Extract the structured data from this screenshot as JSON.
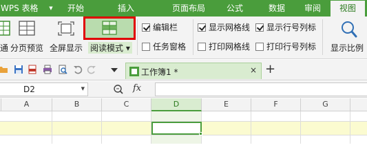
{
  "app": {
    "name": "WPS 表格",
    "menu_dropdown": "▼"
  },
  "menu": {
    "tabs": [
      "开始",
      "插入",
      "页面布局",
      "公式",
      "数据",
      "审阅",
      "视图"
    ],
    "active": "视图"
  },
  "ribbon": {
    "left_cut_label": "通",
    "page_preview": "分页预览",
    "fullscreen": "全屏显示",
    "reading_mode": "阅读模式",
    "reading_mode_dd": "▾",
    "checks": [
      {
        "label": "编辑栏",
        "checked": true
      },
      {
        "label": "任务窗格",
        "checked": false
      },
      {
        "label": "显示网格线",
        "checked": true
      },
      {
        "label": "打印网格线",
        "checked": false
      },
      {
        "label": "显示行号列标",
        "checked": true
      },
      {
        "label": "打印行号列标",
        "checked": false
      }
    ],
    "zoom": "显示比例",
    "highlight_color": "#e00000",
    "accent_color": "#4a9d3c"
  },
  "quick_access": {
    "icons": [
      "open-folder-icon",
      "save-icon",
      "export-pdf-icon",
      "print-icon",
      "print-preview-icon",
      "undo-icon",
      "redo-icon",
      "customize-dropdown-icon"
    ],
    "document_tab": "工作簿1 *",
    "close": "×",
    "new_tab": "+"
  },
  "formula_bar": {
    "name_box": "D2",
    "name_dd": "▼",
    "fx": "fx",
    "value": ""
  },
  "grid": {
    "columns": [
      "A",
      "B",
      "C",
      "D",
      "E",
      "F",
      "G"
    ],
    "selected_column": "D",
    "active_cell": "D2"
  }
}
